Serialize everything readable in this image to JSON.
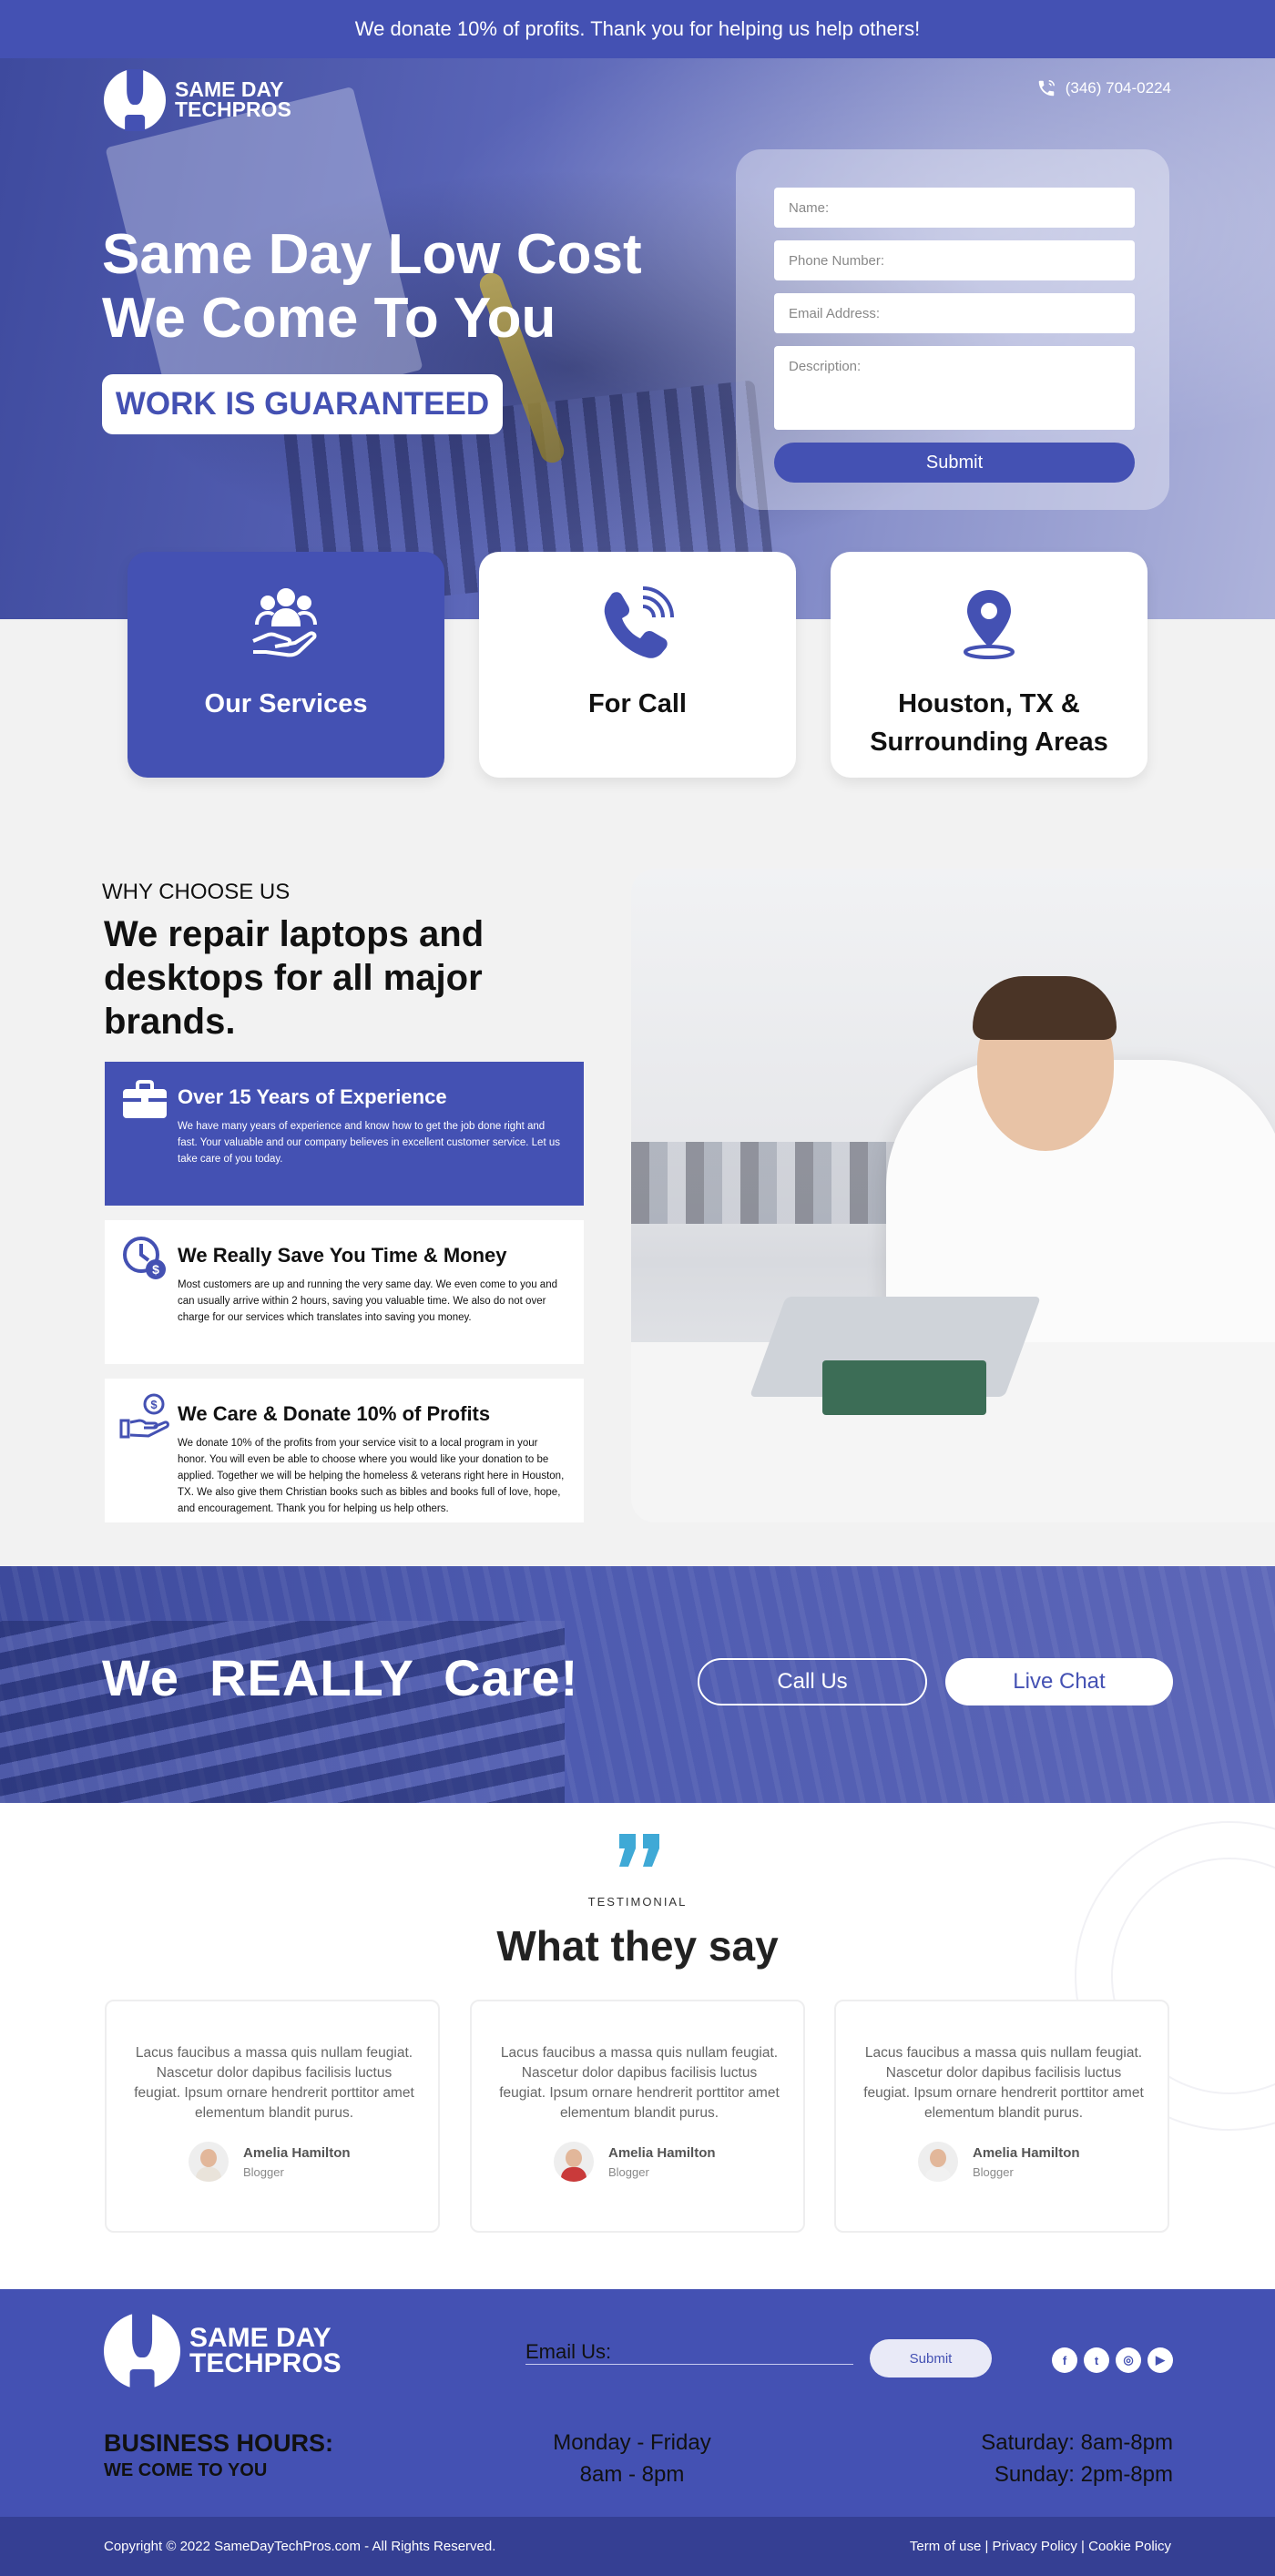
{
  "topbar": {
    "text": "We donate 10% of profits. Thank you for helping us help others!"
  },
  "brand": {
    "line1": "SAME DAY",
    "line2": "TECHPROS"
  },
  "header": {
    "phone": "(346) 704-0224"
  },
  "hero": {
    "title_line1": "Same Day Low Cost",
    "title_line2": "We Come To You",
    "badge": "WORK IS GUARANTEED"
  },
  "form": {
    "name_placeholder": "Name:",
    "phone_placeholder": "Phone Number:",
    "email_placeholder": "Email Address:",
    "description_placeholder": "Description:",
    "submit_label": "Submit"
  },
  "cards": [
    {
      "label": "Our Services",
      "icon": "people-hand-icon"
    },
    {
      "label": "For Call",
      "icon": "phone-icon"
    },
    {
      "label_line1": "Houston, TX &",
      "label_line2": "Surrounding Areas",
      "icon": "map-pin-icon"
    }
  ],
  "why": {
    "kicker": "WHY CHOOSE US",
    "title": "We repair laptops and desktops for all major brands.",
    "features": [
      {
        "title": "Over 15 Years of Experience",
        "text": "We have many years of experience and know how to get the job done right and fast. Your valuable and our company believes in excellent customer service. Let us take care of you today.",
        "icon": "briefcase-icon"
      },
      {
        "title": "We Really Save You Time & Money",
        "text": "Most customers are up and running the very same day. We even come to you and can usually arrive within 2 hours, saving you valuable time. We also do not over charge for our services which translates into saving you money.",
        "icon": "clock-money-icon"
      },
      {
        "title": "We Care & Donate 10% of Profits",
        "text": "We donate 10% of the profits from your service visit to a local program in your honor. You will even be able to choose where you would like your donation to be applied. Together we will be helping the homeless & veterans right here in Houston, TX. We also give them Christian books such as bibles and books full of love, hope, and encouragement. Thank you for helping us help others.",
        "icon": "hand-donate-icon"
      }
    ]
  },
  "care": {
    "title": "We  REALLY  Care!",
    "call_label": "Call Us",
    "chat_label": "Live Chat"
  },
  "testimonials": {
    "kicker": "TESTIMONIAL",
    "title": "What they say",
    "items": [
      {
        "quote": "Lacus faucibus a massa quis nullam feugiat. Nascetur dolor dapibus facilisis luctus feugiat. Ipsum ornare hendrerit porttitor amet elementum blandit purus.",
        "name": "Amelia Hamilton",
        "role": "Blogger"
      },
      {
        "quote": "Lacus faucibus a massa quis nullam feugiat. Nascetur dolor dapibus facilisis luctus feugiat. Ipsum ornare hendrerit porttitor amet elementum blandit purus.",
        "name": "Amelia Hamilton",
        "role": "Blogger"
      },
      {
        "quote": "Lacus faucibus a massa quis nullam feugiat. Nascetur dolor dapibus facilisis luctus feugiat. Ipsum ornare hendrerit porttitor amet elementum blandit purus.",
        "name": "Amelia Hamilton",
        "role": "Blogger"
      }
    ]
  },
  "footer": {
    "email_label": "Email Us:",
    "submit_label": "Submit",
    "social": [
      {
        "name": "facebook-icon",
        "glyph": "f"
      },
      {
        "name": "twitter-icon",
        "glyph": "t"
      },
      {
        "name": "instagram-icon",
        "glyph": "◎"
      },
      {
        "name": "youtube-icon",
        "glyph": "▶"
      }
    ],
    "hours_title": "BUSINESS HOURS:",
    "hours_sub": "WE COME TO YOU",
    "weekday_days": "Monday - Friday",
    "weekday_hours": "8am - 8pm",
    "saturday": "Saturday: 8am-8pm",
    "sunday": "Sunday: 2pm-8pm",
    "copyright": "Copyright © 2022 SameDayTechPros.com - All Rights Reserved.",
    "links": [
      "Term of use",
      "Privacy Policy",
      "Cookie Policy"
    ],
    "link_separator": " | "
  },
  "colors": {
    "brand": "#4451b3",
    "brand_dark": "#353f93",
    "quote_accent": "#3fa9d6"
  }
}
